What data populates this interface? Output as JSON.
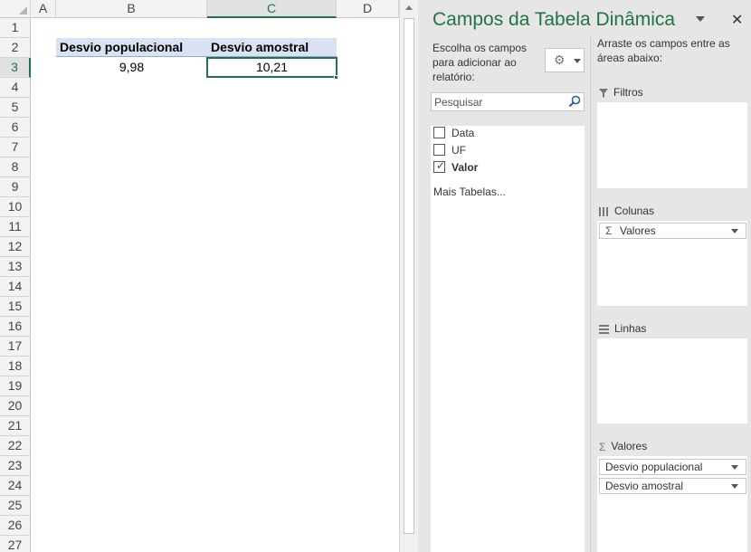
{
  "sheet": {
    "columns": [
      "A",
      "B",
      "C",
      "D"
    ],
    "rows": [
      "1",
      "2",
      "3",
      "4",
      "5",
      "6",
      "7",
      "8",
      "9",
      "10",
      "11",
      "12",
      "13",
      "14",
      "15",
      "16",
      "17",
      "18",
      "19",
      "20",
      "21",
      "22",
      "23",
      "24",
      "25",
      "26",
      "27"
    ],
    "header_b2": "Desvio populacional",
    "header_c2": "Desvio amostral",
    "value_b3": "9,98",
    "value_c3": "10,21",
    "selected_column": "C",
    "selected_row": "3"
  },
  "pane": {
    "title": "Campos da Tabela Dinâmica",
    "choose_text": "Escolha os campos para adicionar ao relatório:",
    "search_placeholder": "Pesquisar",
    "fields": [
      {
        "label": "Data",
        "checked": false
      },
      {
        "label": "UF",
        "checked": false
      },
      {
        "label": "Valor",
        "checked": true
      }
    ],
    "more_tables": "Mais Tabelas...",
    "drag_text": "Arraste os campos entre as áreas abaixo:",
    "areas": {
      "filters": "Filtros",
      "columns": "Colunas",
      "rows": "Linhas",
      "values": "Valores"
    },
    "columns_items": [
      "Valores"
    ],
    "values_items": [
      "Desvio populacional",
      "Desvio amostral"
    ]
  }
}
